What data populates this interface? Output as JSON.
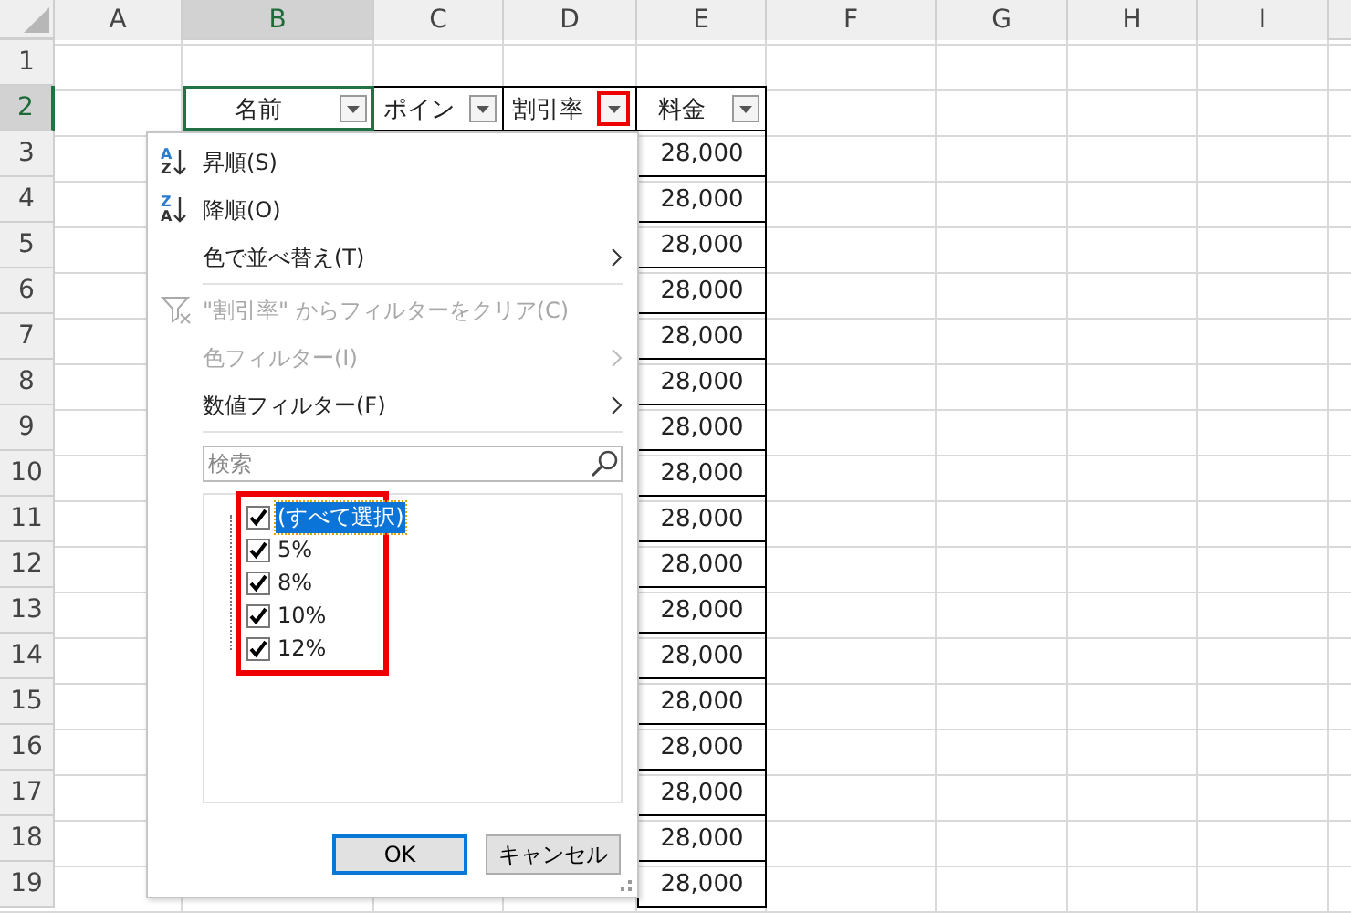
{
  "columns": [
    {
      "label": "A",
      "selected": false
    },
    {
      "label": "B",
      "selected": true
    },
    {
      "label": "C",
      "selected": false
    },
    {
      "label": "D",
      "selected": false
    },
    {
      "label": "E",
      "selected": false
    },
    {
      "label": "F",
      "selected": false
    },
    {
      "label": "G",
      "selected": false
    },
    {
      "label": "H",
      "selected": false
    },
    {
      "label": "I",
      "selected": false
    }
  ],
  "rows": [
    {
      "label": "1",
      "selected": false
    },
    {
      "label": "2",
      "selected": true
    },
    {
      "label": "3",
      "selected": false
    },
    {
      "label": "4",
      "selected": false
    },
    {
      "label": "5",
      "selected": false
    },
    {
      "label": "6",
      "selected": false
    },
    {
      "label": "7",
      "selected": false
    },
    {
      "label": "8",
      "selected": false
    },
    {
      "label": "9",
      "selected": false
    },
    {
      "label": "10",
      "selected": false
    },
    {
      "label": "11",
      "selected": false
    },
    {
      "label": "12",
      "selected": false
    },
    {
      "label": "13",
      "selected": false
    },
    {
      "label": "14",
      "selected": false
    },
    {
      "label": "15",
      "selected": false
    },
    {
      "label": "16",
      "selected": false
    },
    {
      "label": "17",
      "selected": false
    },
    {
      "label": "18",
      "selected": false
    },
    {
      "label": "19",
      "selected": false
    }
  ],
  "table": {
    "headers": [
      {
        "label": "名前",
        "selected": true,
        "highlighted": false
      },
      {
        "label": "ポイン",
        "selected": false,
        "highlighted": false
      },
      {
        "label": "割引率",
        "selected": false,
        "highlighted": true
      },
      {
        "label": "料金",
        "selected": false,
        "highlighted": false
      }
    ],
    "fees": [
      "28,000",
      "28,000",
      "28,000",
      "28,000",
      "28,000",
      "28,000",
      "28,000",
      "28,000",
      "28,000",
      "28,000",
      "28,000",
      "28,000",
      "28,000",
      "28,000",
      "28,000",
      "28,000",
      "28,000"
    ]
  },
  "filter_menu": {
    "items": [
      {
        "kind": "sort",
        "label": "昇順(S)",
        "icon_letters": [
          "A",
          "Z"
        ],
        "disabled": false,
        "separator_after": false
      },
      {
        "kind": "sort",
        "label": "降順(O)",
        "icon_letters": [
          "Z",
          "A"
        ],
        "disabled": false,
        "separator_after": false
      },
      {
        "kind": "submenu",
        "label": "色で並べ替え(T)",
        "disabled": false,
        "separator_after": true
      },
      {
        "kind": "clear",
        "label": "\"割引率\" からフィルターをクリア(C)",
        "disabled": true,
        "separator_after": false
      },
      {
        "kind": "submenu",
        "label": "色フィルター(I)",
        "disabled": true,
        "separator_after": false
      },
      {
        "kind": "submenu",
        "label": "数値フィルター(F)",
        "disabled": false,
        "separator_after": true
      }
    ],
    "search": {
      "placeholder": "検索"
    },
    "checklist": {
      "highlighted": true,
      "items": [
        {
          "label": "(すべて選択)",
          "checked": true,
          "selected": true
        },
        {
          "label": "5%",
          "checked": true,
          "selected": false
        },
        {
          "label": "8%",
          "checked": true,
          "selected": false
        },
        {
          "label": "10%",
          "checked": true,
          "selected": false
        },
        {
          "label": "12%",
          "checked": true,
          "selected": false
        }
      ]
    },
    "buttons": [
      {
        "label": "OK",
        "default": true
      },
      {
        "label": "キャンセル",
        "default": false
      }
    ]
  }
}
